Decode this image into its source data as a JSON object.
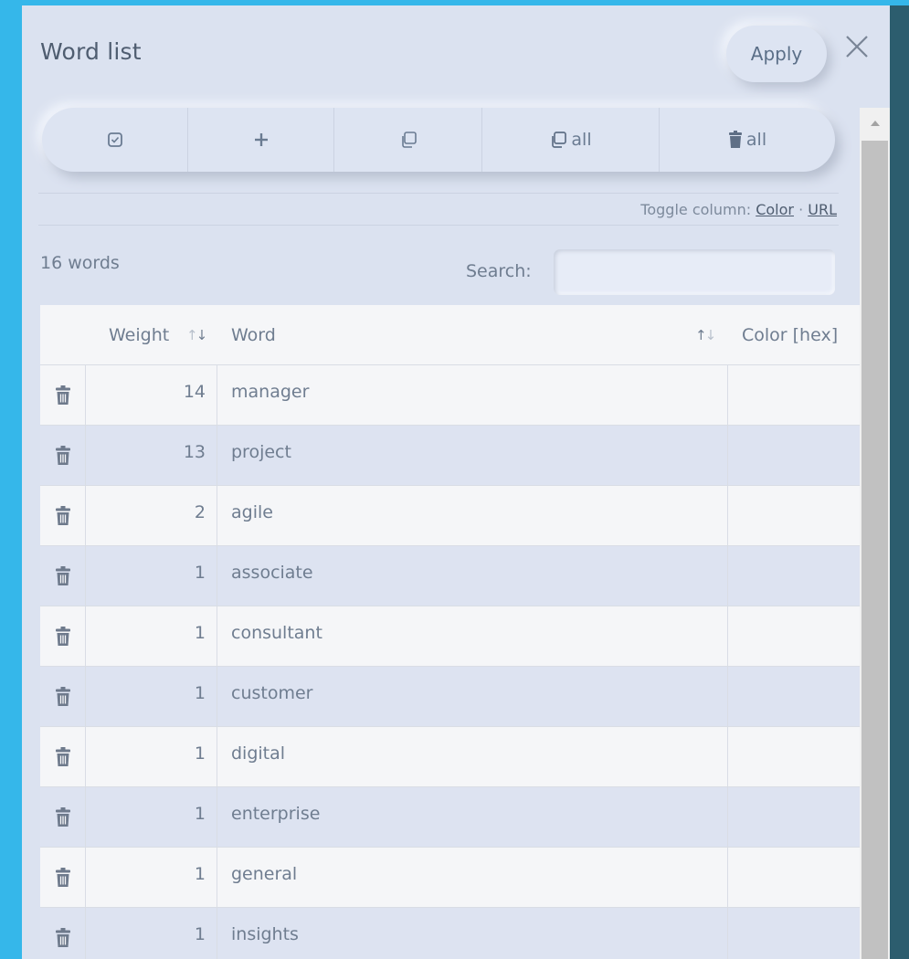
{
  "dialog": {
    "title": "Word list",
    "apply_label": "Apply"
  },
  "toolbar": {
    "copy_all_label": "all",
    "delete_all_label": "all"
  },
  "toggle": {
    "prefix": "Toggle column: ",
    "color_link": "Color",
    "separator": " · ",
    "url_link": "URL"
  },
  "count_label": "16 words",
  "search": {
    "label": "Search:",
    "value": ""
  },
  "table": {
    "headers": {
      "weight": "Weight",
      "word": "Word",
      "color": "Color [hex]"
    },
    "rows": [
      {
        "weight": "14",
        "word": "manager",
        "color": ""
      },
      {
        "weight": "13",
        "word": "project",
        "color": ""
      },
      {
        "weight": "2",
        "word": "agile",
        "color": ""
      },
      {
        "weight": "1",
        "word": "associate",
        "color": ""
      },
      {
        "weight": "1",
        "word": "consultant",
        "color": ""
      },
      {
        "weight": "1",
        "word": "customer",
        "color": ""
      },
      {
        "weight": "1",
        "word": "digital",
        "color": ""
      },
      {
        "weight": "1",
        "word": "enterprise",
        "color": ""
      },
      {
        "weight": "1",
        "word": "general",
        "color": ""
      },
      {
        "weight": "1",
        "word": "insights",
        "color": ""
      }
    ]
  },
  "colors": {
    "page_left": "#35b7ea",
    "page_right": "#2c5d6e",
    "panel": "#dbe2f0",
    "row_alt": "#dde3f1",
    "trash": "#6e7a8c"
  }
}
